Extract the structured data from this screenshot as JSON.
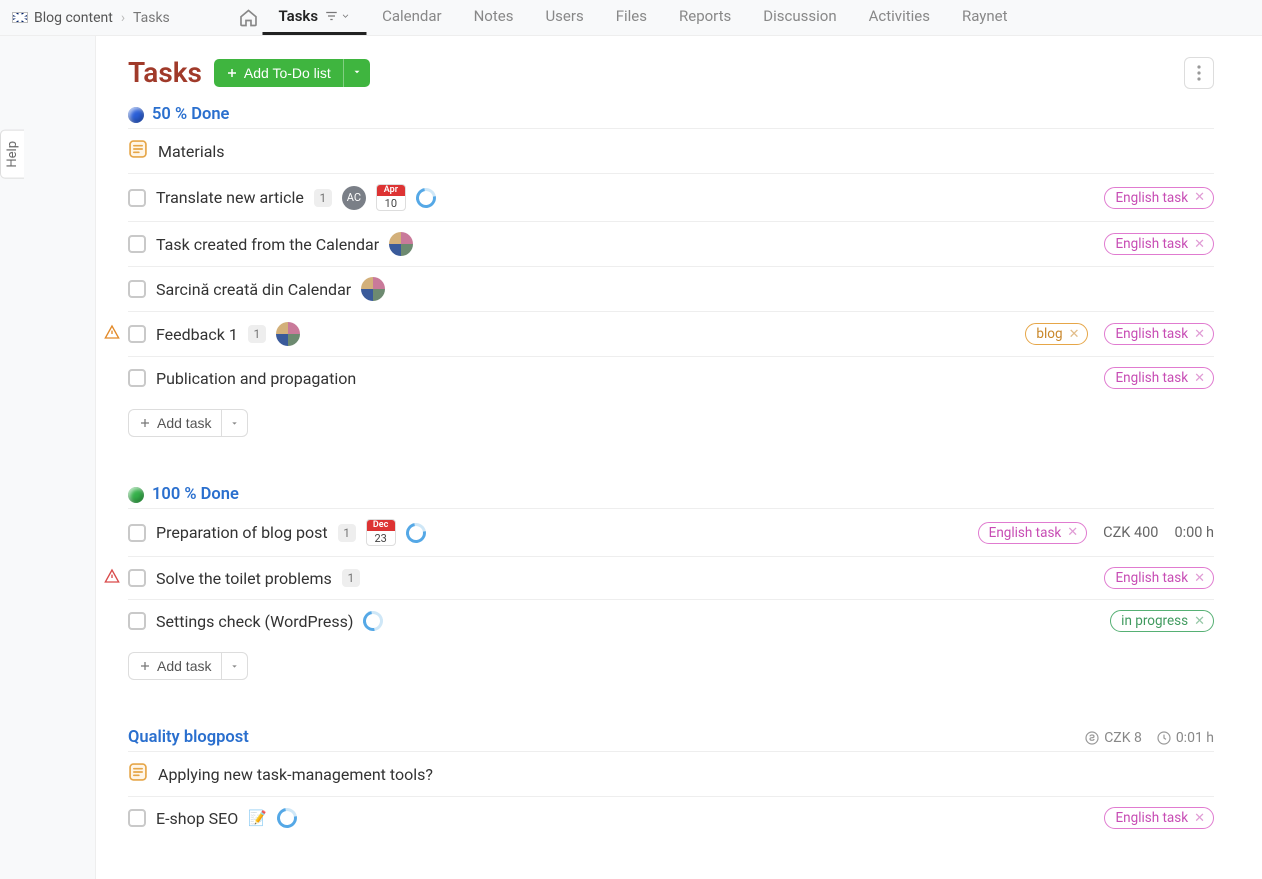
{
  "breadcrumb": {
    "project": "Blog content",
    "page": "Tasks"
  },
  "nav": {
    "items": [
      "Tasks",
      "Calendar",
      "Notes",
      "Users",
      "Files",
      "Reports",
      "Discussion",
      "Activities",
      "Raynet"
    ],
    "active": "Tasks"
  },
  "help_label": "Help",
  "page_title": "Tasks",
  "add_button": {
    "label": "Add To-Do list"
  },
  "add_task_label": "Add task",
  "sections": [
    {
      "id": "s50",
      "status_color": "#2a5fd8",
      "title": "50 % Done",
      "tasks": [
        {
          "type": "note",
          "name": "Materials"
        },
        {
          "type": "todo",
          "name": "Translate new article",
          "count": "1",
          "avatar": "ac",
          "avatar_label": "AC",
          "date_m": "Apr",
          "date_d": "10",
          "ring": "open",
          "tags": [
            {
              "kind": "pink",
              "label": "English task"
            }
          ]
        },
        {
          "type": "todo",
          "name": "Task created from the Calendar",
          "avatar": "photo",
          "tags": [
            {
              "kind": "pink",
              "label": "English task"
            }
          ]
        },
        {
          "type": "todo",
          "name": "Sarcină creată din Calendar",
          "avatar": "photo"
        },
        {
          "type": "todo",
          "name": "Feedback 1",
          "count": "1",
          "avatar": "photo",
          "warn": "orange",
          "tags": [
            {
              "kind": "orange",
              "label": "blog"
            },
            {
              "kind": "pink",
              "label": "English task"
            }
          ]
        },
        {
          "type": "todo",
          "name": "Publication and propagation",
          "tags": [
            {
              "kind": "pink",
              "label": "English task"
            }
          ]
        }
      ],
      "show_add": true
    },
    {
      "id": "s100",
      "status_color": "#35b14a",
      "title": "100 % Done",
      "tasks": [
        {
          "type": "todo",
          "name": "Preparation of blog post",
          "count": "1",
          "date_m": "Dec",
          "date_d": "23",
          "ring": "open",
          "tags": [
            {
              "kind": "pink",
              "label": "English task"
            }
          ],
          "meta_cost": "CZK 400",
          "meta_time": "0:00 h"
        },
        {
          "type": "todo",
          "name": "Solve the toilet problems",
          "count": "1",
          "warn": "red",
          "tags": [
            {
              "kind": "pink",
              "label": "English task"
            }
          ]
        },
        {
          "type": "todo",
          "name": "Settings check (WordPress)",
          "ring": "partial",
          "tags": [
            {
              "kind": "green",
              "label": "in progress"
            }
          ]
        }
      ],
      "show_add": true
    },
    {
      "id": "sq",
      "title": "Quality blogpost",
      "plain": true,
      "header_cost": "CZK 8",
      "header_time": "0:01 h",
      "tasks": [
        {
          "type": "note",
          "name": "Applying new task-management tools?"
        },
        {
          "type": "todo",
          "name": "E-shop SEO",
          "pencil": true,
          "ring": "open",
          "tags": [
            {
              "kind": "pink",
              "label": "English task"
            }
          ]
        }
      ]
    }
  ]
}
